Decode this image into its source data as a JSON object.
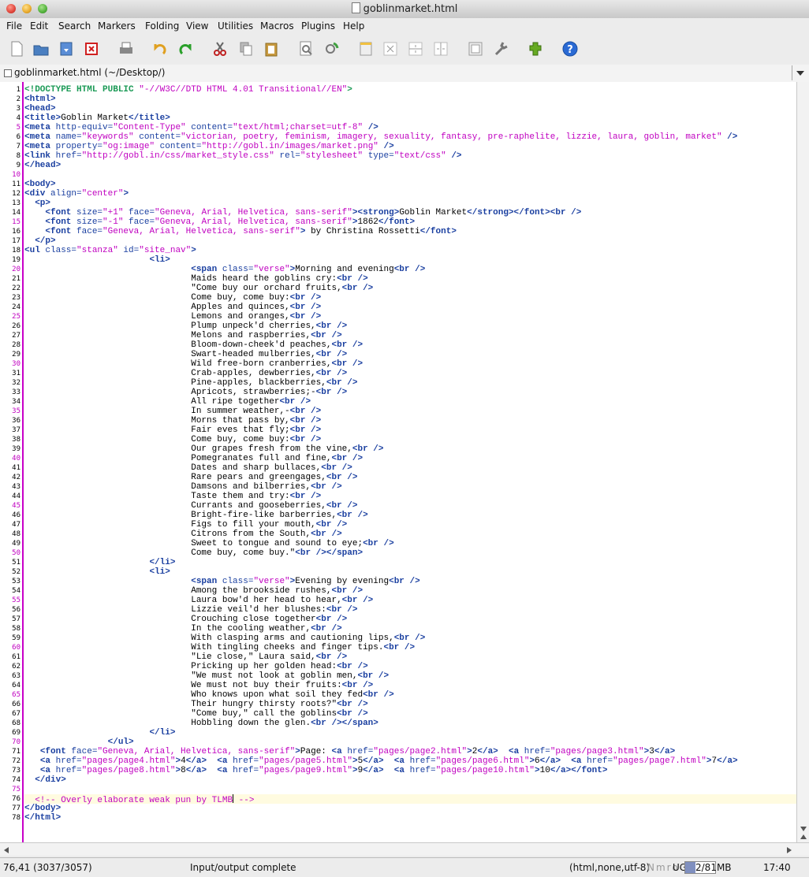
{
  "window": {
    "title": "goblinmarket.html"
  },
  "menu": [
    "File",
    "Edit",
    "Search",
    "Markers",
    "Folding",
    "View",
    "Utilities",
    "Macros",
    "Plugins",
    "Help"
  ],
  "toolbar": [
    {
      "name": "new-file-icon",
      "color": "#ffffff"
    },
    {
      "name": "open-folder-icon",
      "color": "#4a7fc1"
    },
    {
      "name": "save-icon",
      "color": "#5a8dd6"
    },
    {
      "name": "close-buffer-icon",
      "color": "#d02020"
    },
    {
      "name": "print-icon",
      "color": "#888888"
    },
    {
      "name": "undo-icon",
      "color": "#e0a020"
    },
    {
      "name": "redo-icon",
      "color": "#2aa02a"
    },
    {
      "name": "cut-icon",
      "color": "#c02020"
    },
    {
      "name": "copy-icon",
      "color": "#bbbbbb"
    },
    {
      "name": "paste-icon",
      "color": "#c89a40"
    },
    {
      "name": "find-icon",
      "color": "#777777"
    },
    {
      "name": "find-next-icon",
      "color": "#40a040"
    },
    {
      "name": "new-view-icon",
      "color": "#eeeeee"
    },
    {
      "name": "unsplit-icon",
      "color": "#bbbbbb"
    },
    {
      "name": "split-horizontal-icon",
      "color": "#bbbbbb"
    },
    {
      "name": "split-vertical-icon",
      "color": "#bbbbbb"
    },
    {
      "name": "buffer-options-icon",
      "color": "#999999"
    },
    {
      "name": "global-options-icon",
      "color": "#777777"
    },
    {
      "name": "plugin-manager-icon",
      "color": "#66aa22"
    },
    {
      "name": "help-icon",
      "color": "#2a6ad4"
    }
  ],
  "buffer": {
    "label": "goblinmarket.html (~/Desktop/)"
  },
  "status": {
    "position": "76,41 (3037/3057)",
    "message": "Input/output complete",
    "mode": "(html,none,utf-8)",
    "flags": "Nmro",
    "ug": "UG",
    "memory": "2/81MB",
    "memory_fraction": 0.35,
    "clock": "17:40"
  },
  "lines": [
    [
      [
        "dt",
        "<!DOCTYPE HTML PUBLIC "
      ],
      [
        "str",
        "\"-//W3C//DTD HTML 4.01 Transitional//EN\""
      ],
      [
        "dt",
        ">"
      ]
    ],
    [
      [
        "tag",
        "<html>"
      ]
    ],
    [
      [
        "tag",
        "<head>"
      ]
    ],
    [
      [
        "tag",
        "<title>"
      ],
      [
        "txt",
        "Goblin Market"
      ],
      [
        "tag",
        "</title>"
      ]
    ],
    [
      [
        "tag",
        "<meta "
      ],
      [
        "attr",
        "http-equiv="
      ],
      [
        "str",
        "\"Content-Type\""
      ],
      [
        "attr",
        " content="
      ],
      [
        "str",
        "\"text/html;charset=utf-8\""
      ],
      [
        "tag",
        " />"
      ]
    ],
    [
      [
        "tag",
        "<meta "
      ],
      [
        "attr",
        "name="
      ],
      [
        "str",
        "\"keywords\""
      ],
      [
        "attr",
        " content="
      ],
      [
        "str",
        "\"victorian, poetry, feminism, imagery, sexuality, fantasy, pre-raphelite, lizzie, laura, goblin, market\""
      ],
      [
        "tag",
        " />"
      ]
    ],
    [
      [
        "tag",
        "<meta "
      ],
      [
        "attr",
        "property="
      ],
      [
        "str",
        "\"og:image\""
      ],
      [
        "attr",
        " content="
      ],
      [
        "str",
        "\"http://gobl.in/images/market.png\""
      ],
      [
        "tag",
        " />"
      ]
    ],
    [
      [
        "tag",
        "<link "
      ],
      [
        "attr",
        "href="
      ],
      [
        "str",
        "\"http://gobl.in/css/market_style.css\""
      ],
      [
        "attr",
        " rel="
      ],
      [
        "str",
        "\"stylesheet\""
      ],
      [
        "attr",
        " type="
      ],
      [
        "str",
        "\"text/css\""
      ],
      [
        "tag",
        " />"
      ]
    ],
    [
      [
        "tag",
        "</head>"
      ]
    ],
    [],
    [
      [
        "tag",
        "<body>"
      ]
    ],
    [
      [
        "tag",
        "<div "
      ],
      [
        "attr",
        "align="
      ],
      [
        "str",
        "\"center\""
      ],
      [
        "tag",
        ">"
      ]
    ],
    [
      [
        "txt",
        "  "
      ],
      [
        "tag",
        "<p>"
      ]
    ],
    [
      [
        "txt",
        "    "
      ],
      [
        "tag",
        "<font "
      ],
      [
        "attr",
        "size="
      ],
      [
        "str",
        "\"+1\""
      ],
      [
        "attr",
        " face="
      ],
      [
        "str",
        "\"Geneva, Arial, Helvetica, sans-serif\""
      ],
      [
        "tag",
        "><strong>"
      ],
      [
        "txt",
        "Goblin Market"
      ],
      [
        "tag",
        "</strong></font><br />"
      ]
    ],
    [
      [
        "txt",
        "    "
      ],
      [
        "tag",
        "<font "
      ],
      [
        "attr",
        "size="
      ],
      [
        "str",
        "\"-1\""
      ],
      [
        "attr",
        " face="
      ],
      [
        "str",
        "\"Geneva, Arial, Helvetica, sans-serif\""
      ],
      [
        "tag",
        ">"
      ],
      [
        "txt",
        "1862"
      ],
      [
        "tag",
        "</font>"
      ]
    ],
    [
      [
        "txt",
        "    "
      ],
      [
        "tag",
        "<font "
      ],
      [
        "attr",
        "face="
      ],
      [
        "str",
        "\"Geneva, Arial, Helvetica, sans-serif\""
      ],
      [
        "tag",
        ">"
      ],
      [
        "txt",
        " by Christina Rossetti"
      ],
      [
        "tag",
        "</font>"
      ]
    ],
    [
      [
        "txt",
        "  "
      ],
      [
        "tag",
        "</p>"
      ]
    ],
    [
      [
        "tag",
        "<ul "
      ],
      [
        "attr",
        "class="
      ],
      [
        "str",
        "\"stanza\""
      ],
      [
        "attr",
        " id="
      ],
      [
        "str",
        "\"site_nav\""
      ],
      [
        "tag",
        ">"
      ]
    ],
    [
      [
        "txt",
        "                        "
      ],
      [
        "tag",
        "<li>"
      ]
    ],
    [
      [
        "txt",
        "                                "
      ],
      [
        "tag",
        "<span "
      ],
      [
        "attr",
        "class="
      ],
      [
        "str",
        "\"verse\""
      ],
      [
        "tag",
        ">"
      ],
      [
        "txt",
        "Morning and evening"
      ],
      [
        "tag",
        "<br />"
      ]
    ],
    [
      [
        "txt",
        "                                Maids heard the goblins cry:"
      ],
      [
        "tag",
        "<br />"
      ]
    ],
    [
      [
        "txt",
        "                                \"Come buy our orchard fruits,"
      ],
      [
        "tag",
        "<br />"
      ]
    ],
    [
      [
        "txt",
        "                                Come buy, come buy:"
      ],
      [
        "tag",
        "<br />"
      ]
    ],
    [
      [
        "txt",
        "                                Apples and quinces,"
      ],
      [
        "tag",
        "<br />"
      ]
    ],
    [
      [
        "txt",
        "                                Lemons and oranges,"
      ],
      [
        "tag",
        "<br />"
      ]
    ],
    [
      [
        "txt",
        "                                Plump unpeck'd cherries,"
      ],
      [
        "tag",
        "<br />"
      ]
    ],
    [
      [
        "txt",
        "                                Melons and raspberries,"
      ],
      [
        "tag",
        "<br />"
      ]
    ],
    [
      [
        "txt",
        "                                Bloom-down-cheek'd peaches,"
      ],
      [
        "tag",
        "<br />"
      ]
    ],
    [
      [
        "txt",
        "                                Swart-headed mulberries,"
      ],
      [
        "tag",
        "<br />"
      ]
    ],
    [
      [
        "txt",
        "                                Wild free-born cranberries,"
      ],
      [
        "tag",
        "<br />"
      ]
    ],
    [
      [
        "txt",
        "                                Crab-apples, dewberries,"
      ],
      [
        "tag",
        "<br />"
      ]
    ],
    [
      [
        "txt",
        "                                Pine-apples, blackberries,"
      ],
      [
        "tag",
        "<br />"
      ]
    ],
    [
      [
        "txt",
        "                                Apricots, strawberries;-"
      ],
      [
        "tag",
        "<br />"
      ]
    ],
    [
      [
        "txt",
        "                                All ripe together"
      ],
      [
        "tag",
        "<br />"
      ]
    ],
    [
      [
        "txt",
        "                                In summer weather,-"
      ],
      [
        "tag",
        "<br />"
      ]
    ],
    [
      [
        "txt",
        "                                Morns that pass by,"
      ],
      [
        "tag",
        "<br />"
      ]
    ],
    [
      [
        "txt",
        "                                Fair eves that fly;"
      ],
      [
        "tag",
        "<br />"
      ]
    ],
    [
      [
        "txt",
        "                                Come buy, come buy:"
      ],
      [
        "tag",
        "<br />"
      ]
    ],
    [
      [
        "txt",
        "                                Our grapes fresh from the vine,"
      ],
      [
        "tag",
        "<br />"
      ]
    ],
    [
      [
        "txt",
        "                                Pomegranates full and fine,"
      ],
      [
        "tag",
        "<br />"
      ]
    ],
    [
      [
        "txt",
        "                                Dates and sharp bullaces,"
      ],
      [
        "tag",
        "<br />"
      ]
    ],
    [
      [
        "txt",
        "                                Rare pears and greengages,"
      ],
      [
        "tag",
        "<br />"
      ]
    ],
    [
      [
        "txt",
        "                                Damsons and bilberries,"
      ],
      [
        "tag",
        "<br />"
      ]
    ],
    [
      [
        "txt",
        "                                Taste them and try:"
      ],
      [
        "tag",
        "<br />"
      ]
    ],
    [
      [
        "txt",
        "                                Currants and gooseberries,"
      ],
      [
        "tag",
        "<br />"
      ]
    ],
    [
      [
        "txt",
        "                                Bright-fire-like barberries,"
      ],
      [
        "tag",
        "<br />"
      ]
    ],
    [
      [
        "txt",
        "                                Figs to fill your mouth,"
      ],
      [
        "tag",
        "<br />"
      ]
    ],
    [
      [
        "txt",
        "                                Citrons from the South,"
      ],
      [
        "tag",
        "<br />"
      ]
    ],
    [
      [
        "txt",
        "                                Sweet to tongue and sound to eye;"
      ],
      [
        "tag",
        "<br />"
      ]
    ],
    [
      [
        "txt",
        "                                Come buy, come buy.\""
      ],
      [
        "tag",
        "<br /></span>"
      ]
    ],
    [
      [
        "txt",
        "                        "
      ],
      [
        "tag",
        "</li>"
      ]
    ],
    [
      [
        "txt",
        "                        "
      ],
      [
        "tag",
        "<li>"
      ]
    ],
    [
      [
        "txt",
        "                                "
      ],
      [
        "tag",
        "<span "
      ],
      [
        "attr",
        "class="
      ],
      [
        "str",
        "\"verse\""
      ],
      [
        "tag",
        ">"
      ],
      [
        "txt",
        "Evening by evening"
      ],
      [
        "tag",
        "<br />"
      ]
    ],
    [
      [
        "txt",
        "                                Among the brookside rushes,"
      ],
      [
        "tag",
        "<br />"
      ]
    ],
    [
      [
        "txt",
        "                                Laura bow'd her head to hear,"
      ],
      [
        "tag",
        "<br />"
      ]
    ],
    [
      [
        "txt",
        "                                Lizzie veil'd her blushes:"
      ],
      [
        "tag",
        "<br />"
      ]
    ],
    [
      [
        "txt",
        "                                Crouching close together"
      ],
      [
        "tag",
        "<br />"
      ]
    ],
    [
      [
        "txt",
        "                                In the cooling weather,"
      ],
      [
        "tag",
        "<br />"
      ]
    ],
    [
      [
        "txt",
        "                                With clasping arms and cautioning lips,"
      ],
      [
        "tag",
        "<br />"
      ]
    ],
    [
      [
        "txt",
        "                                With tingling cheeks and finger tips."
      ],
      [
        "tag",
        "<br />"
      ]
    ],
    [
      [
        "txt",
        "                                \"Lie close,\" Laura said,"
      ],
      [
        "tag",
        "<br />"
      ]
    ],
    [
      [
        "txt",
        "                                Pricking up her golden head:"
      ],
      [
        "tag",
        "<br />"
      ]
    ],
    [
      [
        "txt",
        "                                \"We must not look at goblin men,"
      ],
      [
        "tag",
        "<br />"
      ]
    ],
    [
      [
        "txt",
        "                                We must not buy their fruits:"
      ],
      [
        "tag",
        "<br />"
      ]
    ],
    [
      [
        "txt",
        "                                Who knows upon what soil they fed"
      ],
      [
        "tag",
        "<br />"
      ]
    ],
    [
      [
        "txt",
        "                                Their hungry thirsty roots?\""
      ],
      [
        "tag",
        "<br />"
      ]
    ],
    [
      [
        "txt",
        "                                \"Come buy,\" call the goblins"
      ],
      [
        "tag",
        "<br />"
      ]
    ],
    [
      [
        "txt",
        "                                Hobbling down the glen."
      ],
      [
        "tag",
        "<br /></span>"
      ]
    ],
    [
      [
        "txt",
        "                        "
      ],
      [
        "tag",
        "</li>"
      ]
    ],
    [
      [
        "txt",
        "                "
      ],
      [
        "tag",
        "</ul>"
      ]
    ],
    [
      [
        "txt",
        "   "
      ],
      [
        "tag",
        "<font "
      ],
      [
        "attr",
        "face="
      ],
      [
        "str",
        "\"Geneva, Arial, Helvetica, sans-serif\""
      ],
      [
        "tag",
        ">"
      ],
      [
        "txt",
        "Page: "
      ],
      [
        "tag",
        "<a "
      ],
      [
        "attr",
        "href="
      ],
      [
        "str",
        "\"pages/page2.html\""
      ],
      [
        "tag",
        ">"
      ],
      [
        "txt",
        "2"
      ],
      [
        "tag",
        "</a>"
      ],
      [
        "txt",
        "  "
      ],
      [
        "tag",
        "<a "
      ],
      [
        "attr",
        "href="
      ],
      [
        "str",
        "\"pages/page3.html\""
      ],
      [
        "tag",
        ">"
      ],
      [
        "txt",
        "3"
      ],
      [
        "tag",
        "</a>"
      ]
    ],
    [
      [
        "txt",
        "   "
      ],
      [
        "tag",
        "<a "
      ],
      [
        "attr",
        "href="
      ],
      [
        "str",
        "\"pages/page4.html\""
      ],
      [
        "tag",
        ">"
      ],
      [
        "txt",
        "4"
      ],
      [
        "tag",
        "</a>"
      ],
      [
        "txt",
        "  "
      ],
      [
        "tag",
        "<a "
      ],
      [
        "attr",
        "href="
      ],
      [
        "str",
        "\"pages/page5.html\""
      ],
      [
        "tag",
        ">"
      ],
      [
        "txt",
        "5"
      ],
      [
        "tag",
        "</a>"
      ],
      [
        "txt",
        "  "
      ],
      [
        "tag",
        "<a "
      ],
      [
        "attr",
        "href="
      ],
      [
        "str",
        "\"pages/page6.html\""
      ],
      [
        "tag",
        ">"
      ],
      [
        "txt",
        "6"
      ],
      [
        "tag",
        "</a>"
      ],
      [
        "txt",
        "  "
      ],
      [
        "tag",
        "<a "
      ],
      [
        "attr",
        "href="
      ],
      [
        "str",
        "\"pages/page7.html\""
      ],
      [
        "tag",
        ">"
      ],
      [
        "txt",
        "7"
      ],
      [
        "tag",
        "</a>"
      ]
    ],
    [
      [
        "txt",
        "   "
      ],
      [
        "tag",
        "<a "
      ],
      [
        "attr",
        "href="
      ],
      [
        "str",
        "\"pages/page8.html\""
      ],
      [
        "tag",
        ">"
      ],
      [
        "txt",
        "8"
      ],
      [
        "tag",
        "</a>"
      ],
      [
        "txt",
        "  "
      ],
      [
        "tag",
        "<a "
      ],
      [
        "attr",
        "href="
      ],
      [
        "str",
        "\"pages/page9.html\""
      ],
      [
        "tag",
        ">"
      ],
      [
        "txt",
        "9"
      ],
      [
        "tag",
        "</a>"
      ],
      [
        "txt",
        "  "
      ],
      [
        "tag",
        "<a "
      ],
      [
        "attr",
        "href="
      ],
      [
        "str",
        "\"pages/page10.html\""
      ],
      [
        "tag",
        ">"
      ],
      [
        "txt",
        "10"
      ],
      [
        "tag",
        "</a></font>"
      ]
    ],
    [
      [
        "txt",
        "  "
      ],
      [
        "tag",
        "</div>"
      ]
    ],
    [],
    [
      [
        "txt",
        "  "
      ],
      [
        "cmt",
        "<!-- Overly elaborate weak pun by TLMB"
      ],
      [
        "caret",
        ""
      ],
      [
        "cmt",
        " -->"
      ]
    ],
    [
      [
        "tag",
        "</body>"
      ]
    ],
    [
      [
        "tag",
        "</html>"
      ]
    ]
  ],
  "current_line": 76
}
